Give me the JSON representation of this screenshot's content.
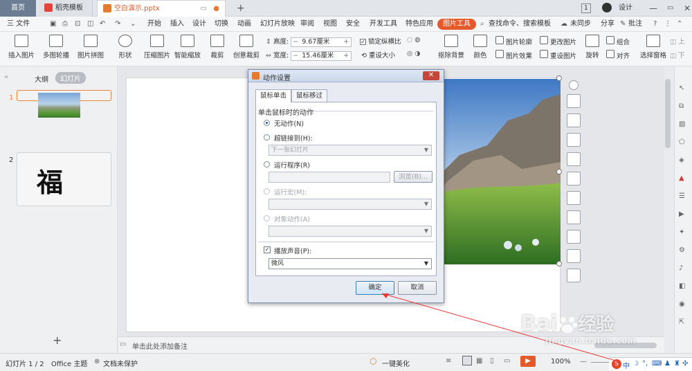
{
  "tabs": [
    {
      "label": "首页"
    },
    {
      "label": "稻壳模板"
    },
    {
      "label": "空白演示.pptx"
    }
  ],
  "header_right": {
    "page_badge": "1",
    "design": "设计"
  },
  "menu": {
    "file": "三 文件",
    "items": [
      "开始",
      "插入",
      "设计",
      "切换",
      "动画",
      "幻灯片放映",
      "审阅",
      "视图",
      "安全",
      "开发工具",
      "特色应用",
      "图片工具"
    ],
    "search": "查找命令、搜索模板",
    "sync": "未同步",
    "share": "分享",
    "comment": "批注"
  },
  "ribbon": {
    "insert_pic": "插入图片",
    "multi_outline": "多图轮播",
    "pic_collage": "图片拼图",
    "shape": "形状",
    "compress": "压缩图片",
    "smart_zoom": "智能缩放",
    "crop": "裁剪",
    "creative_crop": "创意裁剪",
    "height_label": "高度:",
    "height_value": "9.67厘米",
    "width_label": "宽度:",
    "width_value": "15.46厘米",
    "lock_ratio": "锁定纵横比",
    "reset_size": "重设大小",
    "remove_bg": "抠除背景",
    "color": "颜色",
    "pic_outline": "图片轮廓",
    "change_pic": "更改图片",
    "pic_effect": "图片效果",
    "reset_pic": "重设图片",
    "rotate": "旋转",
    "group": "组合",
    "align": "对齐",
    "select_pane": "选择窗格"
  },
  "left_panel": {
    "tab_outline": "大纲",
    "tab_slides": "幻灯片",
    "slides": [
      {
        "num": "1"
      },
      {
        "num": "2",
        "text": "福"
      }
    ],
    "add": "+"
  },
  "notes": {
    "placeholder": "单击此处添加备注"
  },
  "status": {
    "slide_info": "幻灯片 1 / 2",
    "theme": "Office 主题",
    "protect": "文档未保护",
    "beautify": "一键美化",
    "zoom": "100%"
  },
  "dialog": {
    "title": "动作设置",
    "tab_click": "鼠标单击",
    "tab_hover": "鼠标移过",
    "group_label": "单击鼠标时的动作",
    "opt_none": "无动作(N)",
    "opt_link": "超链接到(H):",
    "link_value": "下一张幻灯片",
    "opt_run": "运行程序(R)",
    "browse": "浏览(B)...",
    "opt_macro": "运行宏(M):",
    "opt_object": "对象动作(A)",
    "play_sound": "播放声音(P):",
    "sound_value": "微风",
    "ok": "确定",
    "cancel": "取消"
  },
  "watermark": {
    "brand": "Bai",
    "brand_cn": "经验",
    "url": "jingyan.baidu.com"
  },
  "taskbar_ime": "中",
  "colors": {
    "accent": "#e45a2b",
    "tab_home": "#6b7c93",
    "dialog_border": "#7b8da8"
  }
}
